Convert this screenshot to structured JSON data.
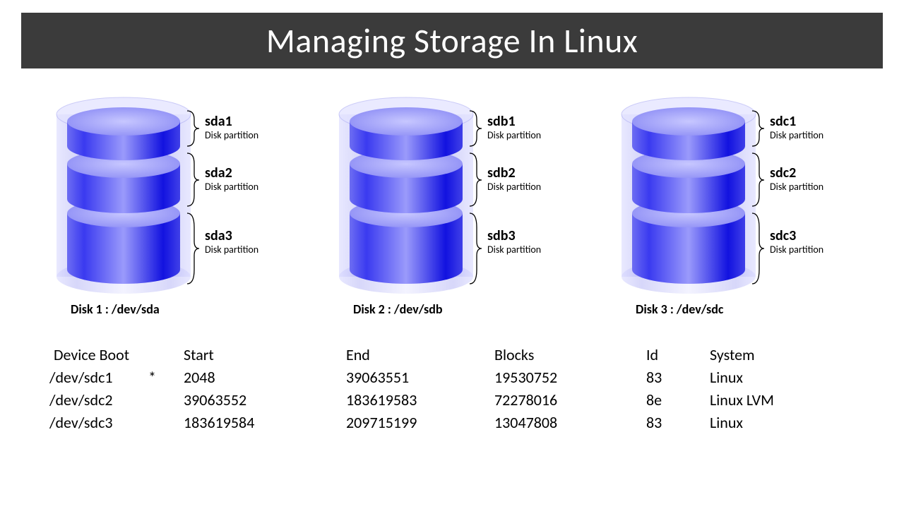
{
  "title": "Managing Storage In Linux",
  "partition_sub": "Disk partition",
  "disks": [
    {
      "caption": "Disk 1 : /dev/sda",
      "parts": [
        "sda1",
        "sda2",
        "sda3"
      ]
    },
    {
      "caption": "Disk 2 : /dev/sdb",
      "parts": [
        "sdb1",
        "sdb2",
        "sdb3"
      ]
    },
    {
      "caption": "Disk 3 : /dev/sdc",
      "parts": [
        "sdc1",
        "sdc2",
        "sdc3"
      ]
    }
  ],
  "table": {
    "headers": {
      "device": "Device",
      "boot": "Boot",
      "start": "Start",
      "end": "End",
      "blocks": "Blocks",
      "id": "Id",
      "system": "System"
    },
    "rows": [
      {
        "device": "/dev/sdc1",
        "boot": "*",
        "start": "2048",
        "end": "39063551",
        "blocks": "19530752",
        "id": "83",
        "system": "Linux"
      },
      {
        "device": "/dev/sdc2",
        "boot": "",
        "start": "39063552",
        "end": "183619583",
        "blocks": "72278016",
        "id": "8e",
        "system": "Linux LVM"
      },
      {
        "device": "/dev/sdc3",
        "boot": "",
        "start": "183619584",
        "end": "209715199",
        "blocks": "13047808",
        "id": "83",
        "system": "Linux"
      }
    ]
  }
}
